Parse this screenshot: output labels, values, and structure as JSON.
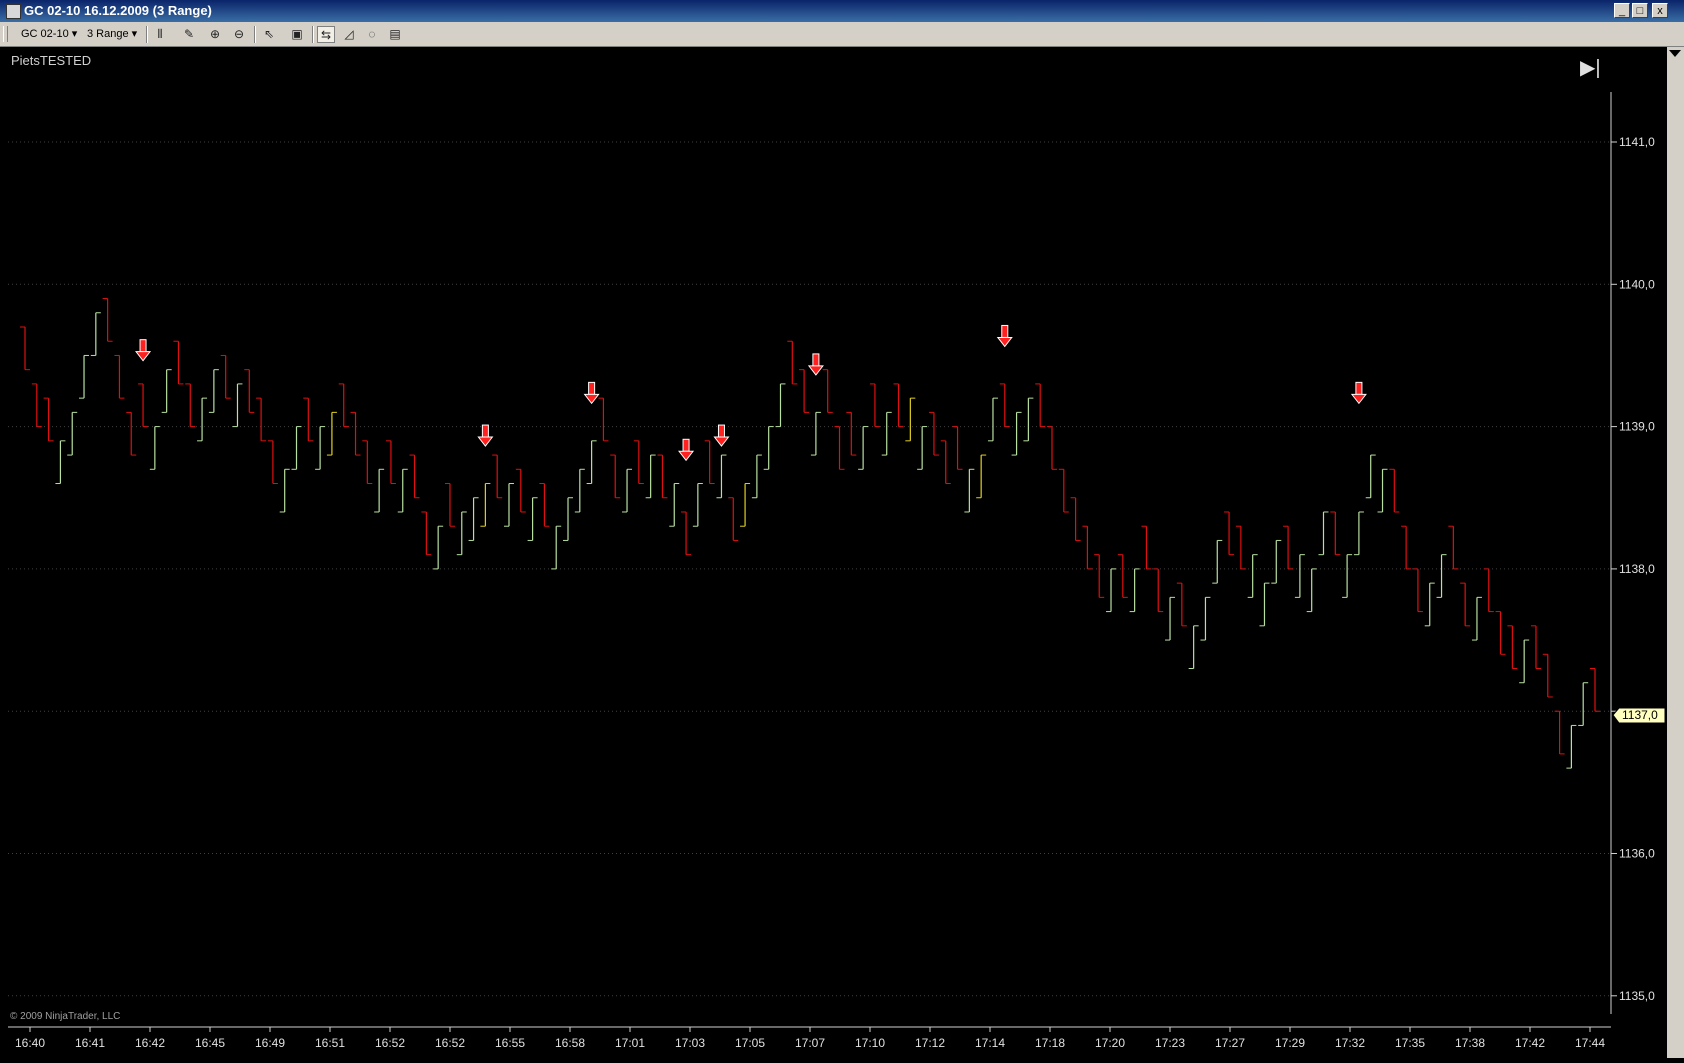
{
  "window": {
    "title": "GC 02-10  16.12.2009 (3 Range)",
    "controls": [
      "_",
      "□",
      "x"
    ]
  },
  "toolbar": {
    "instrument": "GC 02-10",
    "period": "3 Range",
    "icons": [
      "bar-type-icon",
      "draw-tool-icon",
      "zoom-in-icon",
      "zoom-out-icon",
      "pointer-icon",
      "properties-icon",
      "chart-trader-icon",
      "indicators-icon",
      "strategies-icon",
      "data-box-icon"
    ]
  },
  "chart": {
    "label": "PietsTESTED",
    "copyright": "© 2009 NinjaTrader, LLC",
    "current_price": "1137,0",
    "colors": {
      "background": "#000000",
      "up": "#b8e0a0",
      "down": "#e01010",
      "neutral": "#e0d020",
      "grid": "#404040",
      "signal": "#ff2020"
    }
  },
  "chart_data": {
    "type": "bar",
    "bar_type": "OHLC range bars",
    "y_ticks": [
      "1141,0",
      "1140,0",
      "1139,0",
      "1138,0",
      "1137,0",
      "1136,0",
      "1135,0"
    ],
    "y_values": [
      1141.0,
      1140.0,
      1139.0,
      1138.0,
      1137.0,
      1136.0,
      1135.0
    ],
    "ylim": [
      1134.9,
      1141.5
    ],
    "x_ticks": [
      "16:40",
      "16:41",
      "16:42",
      "16:45",
      "16:49",
      "16:51",
      "16:52",
      "16:52",
      "16:55",
      "16:58",
      "17:01",
      "17:03",
      "17:05",
      "17:07",
      "17:10",
      "17:12",
      "17:14",
      "17:18",
      "17:20",
      "17:23",
      "17:27",
      "17:29",
      "17:32",
      "17:35",
      "17:38",
      "17:42",
      "17:44"
    ],
    "grid": "horizontal dotted",
    "bars": [
      {
        "h": 1139.7,
        "l": 1139.4,
        "o": 1139.7,
        "c": 1139.4,
        "d": -1
      },
      {
        "h": 1139.3,
        "l": 1139.0,
        "o": 1139.3,
        "c": 1139.0,
        "d": -1
      },
      {
        "h": 1139.2,
        "l": 1138.9,
        "o": 1139.2,
        "c": 1138.9,
        "d": -1
      },
      {
        "h": 1138.9,
        "l": 1138.6,
        "o": 1138.6,
        "c": 1138.9,
        "d": 1
      },
      {
        "h": 1139.1,
        "l": 1138.8,
        "o": 1138.8,
        "c": 1139.1,
        "d": 1
      },
      {
        "h": 1139.5,
        "l": 1139.2,
        "o": 1139.2,
        "c": 1139.5,
        "d": 1
      },
      {
        "h": 1139.8,
        "l": 1139.5,
        "o": 1139.5,
        "c": 1139.8,
        "d": 1
      },
      {
        "h": 1139.9,
        "l": 1139.6,
        "o": 1139.9,
        "c": 1139.6,
        "d": -1
      },
      {
        "h": 1139.5,
        "l": 1139.2,
        "o": 1139.5,
        "c": 1139.2,
        "d": -1
      },
      {
        "h": 1139.1,
        "l": 1138.8,
        "o": 1139.1,
        "c": 1138.8,
        "d": -1
      },
      {
        "h": 1139.3,
        "l": 1139.0,
        "o": 1139.3,
        "c": 1139.0,
        "d": -1
      },
      {
        "h": 1139.0,
        "l": 1138.7,
        "o": 1138.7,
        "c": 1139.0,
        "d": 1
      },
      {
        "h": 1139.4,
        "l": 1139.1,
        "o": 1139.1,
        "c": 1139.4,
        "d": 1
      },
      {
        "h": 1139.6,
        "l": 1139.3,
        "o": 1139.6,
        "c": 1139.3,
        "d": -1
      },
      {
        "h": 1139.3,
        "l": 1139.0,
        "o": 1139.3,
        "c": 1139.0,
        "d": -1
      },
      {
        "h": 1139.2,
        "l": 1138.9,
        "o": 1138.9,
        "c": 1139.2,
        "d": 1
      },
      {
        "h": 1139.4,
        "l": 1139.1,
        "o": 1139.1,
        "c": 1139.4,
        "d": 1
      },
      {
        "h": 1139.5,
        "l": 1139.2,
        "o": 1139.5,
        "c": 1139.2,
        "d": -1
      },
      {
        "h": 1139.3,
        "l": 1139.0,
        "o": 1139.0,
        "c": 1139.3,
        "d": 1
      },
      {
        "h": 1139.4,
        "l": 1139.1,
        "o": 1139.4,
        "c": 1139.1,
        "d": -1
      },
      {
        "h": 1139.2,
        "l": 1138.9,
        "o": 1139.2,
        "c": 1138.9,
        "d": -1
      },
      {
        "h": 1138.9,
        "l": 1138.6,
        "o": 1138.9,
        "c": 1138.6,
        "d": -1
      },
      {
        "h": 1138.7,
        "l": 1138.4,
        "o": 1138.4,
        "c": 1138.7,
        "d": 1
      },
      {
        "h": 1139.0,
        "l": 1138.7,
        "o": 1138.7,
        "c": 1139.0,
        "d": 1
      },
      {
        "h": 1139.2,
        "l": 1138.9,
        "o": 1139.2,
        "c": 1138.9,
        "d": -1
      },
      {
        "h": 1139.0,
        "l": 1138.7,
        "o": 1138.7,
        "c": 1139.0,
        "d": 1
      },
      {
        "h": 1139.1,
        "l": 1138.8,
        "o": 1138.8,
        "c": 1139.1,
        "d": 0
      },
      {
        "h": 1139.3,
        "l": 1139.0,
        "o": 1139.3,
        "c": 1139.0,
        "d": -1
      },
      {
        "h": 1139.1,
        "l": 1138.8,
        "o": 1139.1,
        "c": 1138.8,
        "d": -1
      },
      {
        "h": 1138.9,
        "l": 1138.6,
        "o": 1138.9,
        "c": 1138.6,
        "d": -1
      },
      {
        "h": 1138.7,
        "l": 1138.4,
        "o": 1138.4,
        "c": 1138.7,
        "d": 1
      },
      {
        "h": 1138.9,
        "l": 1138.6,
        "o": 1138.9,
        "c": 1138.6,
        "d": -1
      },
      {
        "h": 1138.7,
        "l": 1138.4,
        "o": 1138.4,
        "c": 1138.7,
        "d": 1
      },
      {
        "h": 1138.8,
        "l": 1138.5,
        "o": 1138.8,
        "c": 1138.5,
        "d": -1
      },
      {
        "h": 1138.4,
        "l": 1138.1,
        "o": 1138.4,
        "c": 1138.1,
        "d": -1
      },
      {
        "h": 1138.3,
        "l": 1138.0,
        "o": 1138.0,
        "c": 1138.3,
        "d": 1
      },
      {
        "h": 1138.6,
        "l": 1138.3,
        "o": 1138.6,
        "c": 1138.3,
        "d": -1
      },
      {
        "h": 1138.4,
        "l": 1138.1,
        "o": 1138.1,
        "c": 1138.4,
        "d": 1
      },
      {
        "h": 1138.5,
        "l": 1138.2,
        "o": 1138.2,
        "c": 1138.5,
        "d": 1
      },
      {
        "h": 1138.6,
        "l": 1138.3,
        "o": 1138.3,
        "c": 1138.6,
        "d": 0
      },
      {
        "h": 1138.8,
        "l": 1138.5,
        "o": 1138.8,
        "c": 1138.5,
        "d": -1
      },
      {
        "h": 1138.6,
        "l": 1138.3,
        "o": 1138.3,
        "c": 1138.6,
        "d": 1
      },
      {
        "h": 1138.7,
        "l": 1138.4,
        "o": 1138.7,
        "c": 1138.4,
        "d": -1
      },
      {
        "h": 1138.5,
        "l": 1138.2,
        "o": 1138.2,
        "c": 1138.5,
        "d": 1
      },
      {
        "h": 1138.6,
        "l": 1138.3,
        "o": 1138.6,
        "c": 1138.3,
        "d": -1
      },
      {
        "h": 1138.3,
        "l": 1138.0,
        "o": 1138.0,
        "c": 1138.3,
        "d": 1
      },
      {
        "h": 1138.5,
        "l": 1138.2,
        "o": 1138.2,
        "c": 1138.5,
        "d": 1
      },
      {
        "h": 1138.7,
        "l": 1138.4,
        "o": 1138.4,
        "c": 1138.7,
        "d": 1
      },
      {
        "h": 1138.9,
        "l": 1138.6,
        "o": 1138.6,
        "c": 1138.9,
        "d": 1
      },
      {
        "h": 1139.2,
        "l": 1138.9,
        "o": 1139.2,
        "c": 1138.9,
        "d": -1
      },
      {
        "h": 1138.8,
        "l": 1138.5,
        "o": 1138.8,
        "c": 1138.5,
        "d": -1
      },
      {
        "h": 1138.7,
        "l": 1138.4,
        "o": 1138.4,
        "c": 1138.7,
        "d": 1
      },
      {
        "h": 1138.9,
        "l": 1138.6,
        "o": 1138.9,
        "c": 1138.6,
        "d": -1
      },
      {
        "h": 1138.8,
        "l": 1138.5,
        "o": 1138.5,
        "c": 1138.8,
        "d": 1
      },
      {
        "h": 1138.8,
        "l": 1138.5,
        "o": 1138.8,
        "c": 1138.5,
        "d": -1
      },
      {
        "h": 1138.6,
        "l": 1138.3,
        "o": 1138.3,
        "c": 1138.6,
        "d": 1
      },
      {
        "h": 1138.4,
        "l": 1138.1,
        "o": 1138.4,
        "c": 1138.1,
        "d": -1
      },
      {
        "h": 1138.6,
        "l": 1138.3,
        "o": 1138.3,
        "c": 1138.6,
        "d": 1
      },
      {
        "h": 1138.9,
        "l": 1138.6,
        "o": 1138.9,
        "c": 1138.6,
        "d": -1
      },
      {
        "h": 1138.8,
        "l": 1138.5,
        "o": 1138.5,
        "c": 1138.8,
        "d": 1
      },
      {
        "h": 1138.5,
        "l": 1138.2,
        "o": 1138.5,
        "c": 1138.2,
        "d": -1
      },
      {
        "h": 1138.6,
        "l": 1138.3,
        "o": 1138.3,
        "c": 1138.6,
        "d": 0
      },
      {
        "h": 1138.8,
        "l": 1138.5,
        "o": 1138.5,
        "c": 1138.8,
        "d": 1
      },
      {
        "h": 1139.0,
        "l": 1138.7,
        "o": 1138.7,
        "c": 1139.0,
        "d": 1
      },
      {
        "h": 1139.3,
        "l": 1139.0,
        "o": 1139.0,
        "c": 1139.3,
        "d": 1
      },
      {
        "h": 1139.6,
        "l": 1139.3,
        "o": 1139.6,
        "c": 1139.3,
        "d": -1
      },
      {
        "h": 1139.4,
        "l": 1139.1,
        "o": 1139.4,
        "c": 1139.1,
        "d": -1
      },
      {
        "h": 1139.1,
        "l": 1138.8,
        "o": 1138.8,
        "c": 1139.1,
        "d": 1
      },
      {
        "h": 1139.4,
        "l": 1139.1,
        "o": 1139.4,
        "c": 1139.1,
        "d": -1
      },
      {
        "h": 1139.0,
        "l": 1138.7,
        "o": 1139.0,
        "c": 1138.7,
        "d": -1
      },
      {
        "h": 1139.1,
        "l": 1138.8,
        "o": 1139.1,
        "c": 1138.8,
        "d": -1
      },
      {
        "h": 1139.0,
        "l": 1138.7,
        "o": 1138.7,
        "c": 1139.0,
        "d": 1
      },
      {
        "h": 1139.3,
        "l": 1139.0,
        "o": 1139.3,
        "c": 1139.0,
        "d": -1
      },
      {
        "h": 1139.1,
        "l": 1138.8,
        "o": 1138.8,
        "c": 1139.1,
        "d": 1
      },
      {
        "h": 1139.3,
        "l": 1139.0,
        "o": 1139.3,
        "c": 1139.0,
        "d": -1
      },
      {
        "h": 1139.2,
        "l": 1138.9,
        "o": 1138.9,
        "c": 1139.2,
        "d": 0
      },
      {
        "h": 1139.0,
        "l": 1138.7,
        "o": 1138.7,
        "c": 1139.0,
        "d": 1
      },
      {
        "h": 1139.1,
        "l": 1138.8,
        "o": 1139.1,
        "c": 1138.8,
        "d": -1
      },
      {
        "h": 1138.9,
        "l": 1138.6,
        "o": 1138.9,
        "c": 1138.6,
        "d": -1
      },
      {
        "h": 1139.0,
        "l": 1138.7,
        "o": 1139.0,
        "c": 1138.7,
        "d": -1
      },
      {
        "h": 1138.7,
        "l": 1138.4,
        "o": 1138.4,
        "c": 1138.7,
        "d": 1
      },
      {
        "h": 1138.8,
        "l": 1138.5,
        "o": 1138.5,
        "c": 1138.8,
        "d": 0
      },
      {
        "h": 1139.2,
        "l": 1138.9,
        "o": 1138.9,
        "c": 1139.2,
        "d": 1
      },
      {
        "h": 1139.3,
        "l": 1139.0,
        "o": 1139.3,
        "c": 1139.0,
        "d": -1
      },
      {
        "h": 1139.1,
        "l": 1138.8,
        "o": 1138.8,
        "c": 1139.1,
        "d": 1
      },
      {
        "h": 1139.2,
        "l": 1138.9,
        "o": 1138.9,
        "c": 1139.2,
        "d": 1
      },
      {
        "h": 1139.3,
        "l": 1139.0,
        "o": 1139.3,
        "c": 1139.0,
        "d": -1
      },
      {
        "h": 1139.0,
        "l": 1138.7,
        "o": 1139.0,
        "c": 1138.7,
        "d": -1
      },
      {
        "h": 1138.7,
        "l": 1138.4,
        "o": 1138.7,
        "c": 1138.4,
        "d": -1
      },
      {
        "h": 1138.5,
        "l": 1138.2,
        "o": 1138.5,
        "c": 1138.2,
        "d": -1
      },
      {
        "h": 1138.3,
        "l": 1138.0,
        "o": 1138.3,
        "c": 1138.0,
        "d": -1
      },
      {
        "h": 1138.1,
        "l": 1137.8,
        "o": 1138.1,
        "c": 1137.8,
        "d": -1
      },
      {
        "h": 1138.0,
        "l": 1137.7,
        "o": 1137.7,
        "c": 1138.0,
        "d": 1
      },
      {
        "h": 1138.1,
        "l": 1137.8,
        "o": 1138.1,
        "c": 1137.8,
        "d": -1
      },
      {
        "h": 1138.0,
        "l": 1137.7,
        "o": 1137.7,
        "c": 1138.0,
        "d": 1
      },
      {
        "h": 1138.3,
        "l": 1138.0,
        "o": 1138.3,
        "c": 1138.0,
        "d": -1
      },
      {
        "h": 1138.0,
        "l": 1137.7,
        "o": 1138.0,
        "c": 1137.7,
        "d": -1
      },
      {
        "h": 1137.8,
        "l": 1137.5,
        "o": 1137.5,
        "c": 1137.8,
        "d": 1
      },
      {
        "h": 1137.9,
        "l": 1137.6,
        "o": 1137.9,
        "c": 1137.6,
        "d": -1
      },
      {
        "h": 1137.6,
        "l": 1137.3,
        "o": 1137.3,
        "c": 1137.6,
        "d": 1
      },
      {
        "h": 1137.8,
        "l": 1137.5,
        "o": 1137.5,
        "c": 1137.8,
        "d": 1
      },
      {
        "h": 1138.2,
        "l": 1137.9,
        "o": 1137.9,
        "c": 1138.2,
        "d": 1
      },
      {
        "h": 1138.4,
        "l": 1138.1,
        "o": 1138.4,
        "c": 1138.1,
        "d": -1
      },
      {
        "h": 1138.3,
        "l": 1138.0,
        "o": 1138.3,
        "c": 1138.0,
        "d": -1
      },
      {
        "h": 1138.1,
        "l": 1137.8,
        "o": 1137.8,
        "c": 1138.1,
        "d": 1
      },
      {
        "h": 1137.9,
        "l": 1137.6,
        "o": 1137.6,
        "c": 1137.9,
        "d": 1
      },
      {
        "h": 1138.2,
        "l": 1137.9,
        "o": 1137.9,
        "c": 1138.2,
        "d": 1
      },
      {
        "h": 1138.3,
        "l": 1138.0,
        "o": 1138.3,
        "c": 1138.0,
        "d": -1
      },
      {
        "h": 1138.1,
        "l": 1137.8,
        "o": 1137.8,
        "c": 1138.1,
        "d": 1
      },
      {
        "h": 1138.0,
        "l": 1137.7,
        "o": 1137.7,
        "c": 1138.0,
        "d": 1
      },
      {
        "h": 1138.4,
        "l": 1138.1,
        "o": 1138.1,
        "c": 1138.4,
        "d": 1
      },
      {
        "h": 1138.4,
        "l": 1138.1,
        "o": 1138.4,
        "c": 1138.1,
        "d": -1
      },
      {
        "h": 1138.1,
        "l": 1137.8,
        "o": 1137.8,
        "c": 1138.1,
        "d": 1
      },
      {
        "h": 1138.4,
        "l": 1138.1,
        "o": 1138.1,
        "c": 1138.4,
        "d": 1
      },
      {
        "h": 1138.8,
        "l": 1138.5,
        "o": 1138.5,
        "c": 1138.8,
        "d": 1
      },
      {
        "h": 1138.7,
        "l": 1138.4,
        "o": 1138.4,
        "c": 1138.7,
        "d": 1
      },
      {
        "h": 1138.7,
        "l": 1138.4,
        "o": 1138.7,
        "c": 1138.4,
        "d": -1
      },
      {
        "h": 1138.3,
        "l": 1138.0,
        "o": 1138.3,
        "c": 1138.0,
        "d": -1
      },
      {
        "h": 1138.0,
        "l": 1137.7,
        "o": 1138.0,
        "c": 1137.7,
        "d": -1
      },
      {
        "h": 1137.9,
        "l": 1137.6,
        "o": 1137.6,
        "c": 1137.9,
        "d": 1
      },
      {
        "h": 1138.1,
        "l": 1137.8,
        "o": 1137.8,
        "c": 1138.1,
        "d": 1
      },
      {
        "h": 1138.3,
        "l": 1138.0,
        "o": 1138.3,
        "c": 1138.0,
        "d": -1
      },
      {
        "h": 1137.9,
        "l": 1137.6,
        "o": 1137.9,
        "c": 1137.6,
        "d": -1
      },
      {
        "h": 1137.8,
        "l": 1137.5,
        "o": 1137.5,
        "c": 1137.8,
        "d": 1
      },
      {
        "h": 1138.0,
        "l": 1137.7,
        "o": 1138.0,
        "c": 1137.7,
        "d": -1
      },
      {
        "h": 1137.7,
        "l": 1137.4,
        "o": 1137.7,
        "c": 1137.4,
        "d": -1
      },
      {
        "h": 1137.6,
        "l": 1137.3,
        "o": 1137.6,
        "c": 1137.3,
        "d": -1
      },
      {
        "h": 1137.5,
        "l": 1137.2,
        "o": 1137.2,
        "c": 1137.5,
        "d": 1
      },
      {
        "h": 1137.6,
        "l": 1137.3,
        "o": 1137.6,
        "c": 1137.3,
        "d": -1
      },
      {
        "h": 1137.4,
        "l": 1137.1,
        "o": 1137.4,
        "c": 1137.1,
        "d": -1
      },
      {
        "h": 1137.0,
        "l": 1136.7,
        "o": 1137.0,
        "c": 1136.7,
        "d": -1
      },
      {
        "h": 1136.9,
        "l": 1136.6,
        "o": 1136.6,
        "c": 1136.9,
        "d": 1
      },
      {
        "h": 1137.2,
        "l": 1136.9,
        "o": 1136.9,
        "c": 1137.2,
        "d": 1
      },
      {
        "h": 1137.3,
        "l": 1137.0,
        "o": 1137.3,
        "c": 1137.0,
        "d": -1
      }
    ],
    "signals": [
      {
        "bar": 10,
        "price": 1139.4
      },
      {
        "bar": 39,
        "price": 1138.8
      },
      {
        "bar": 48,
        "price": 1139.1
      },
      {
        "bar": 56,
        "price": 1138.7
      },
      {
        "bar": 59,
        "price": 1138.8
      },
      {
        "bar": 67,
        "price": 1139.3
      },
      {
        "bar": 83,
        "price": 1139.5
      },
      {
        "bar": 113,
        "price": 1139.1
      }
    ]
  }
}
